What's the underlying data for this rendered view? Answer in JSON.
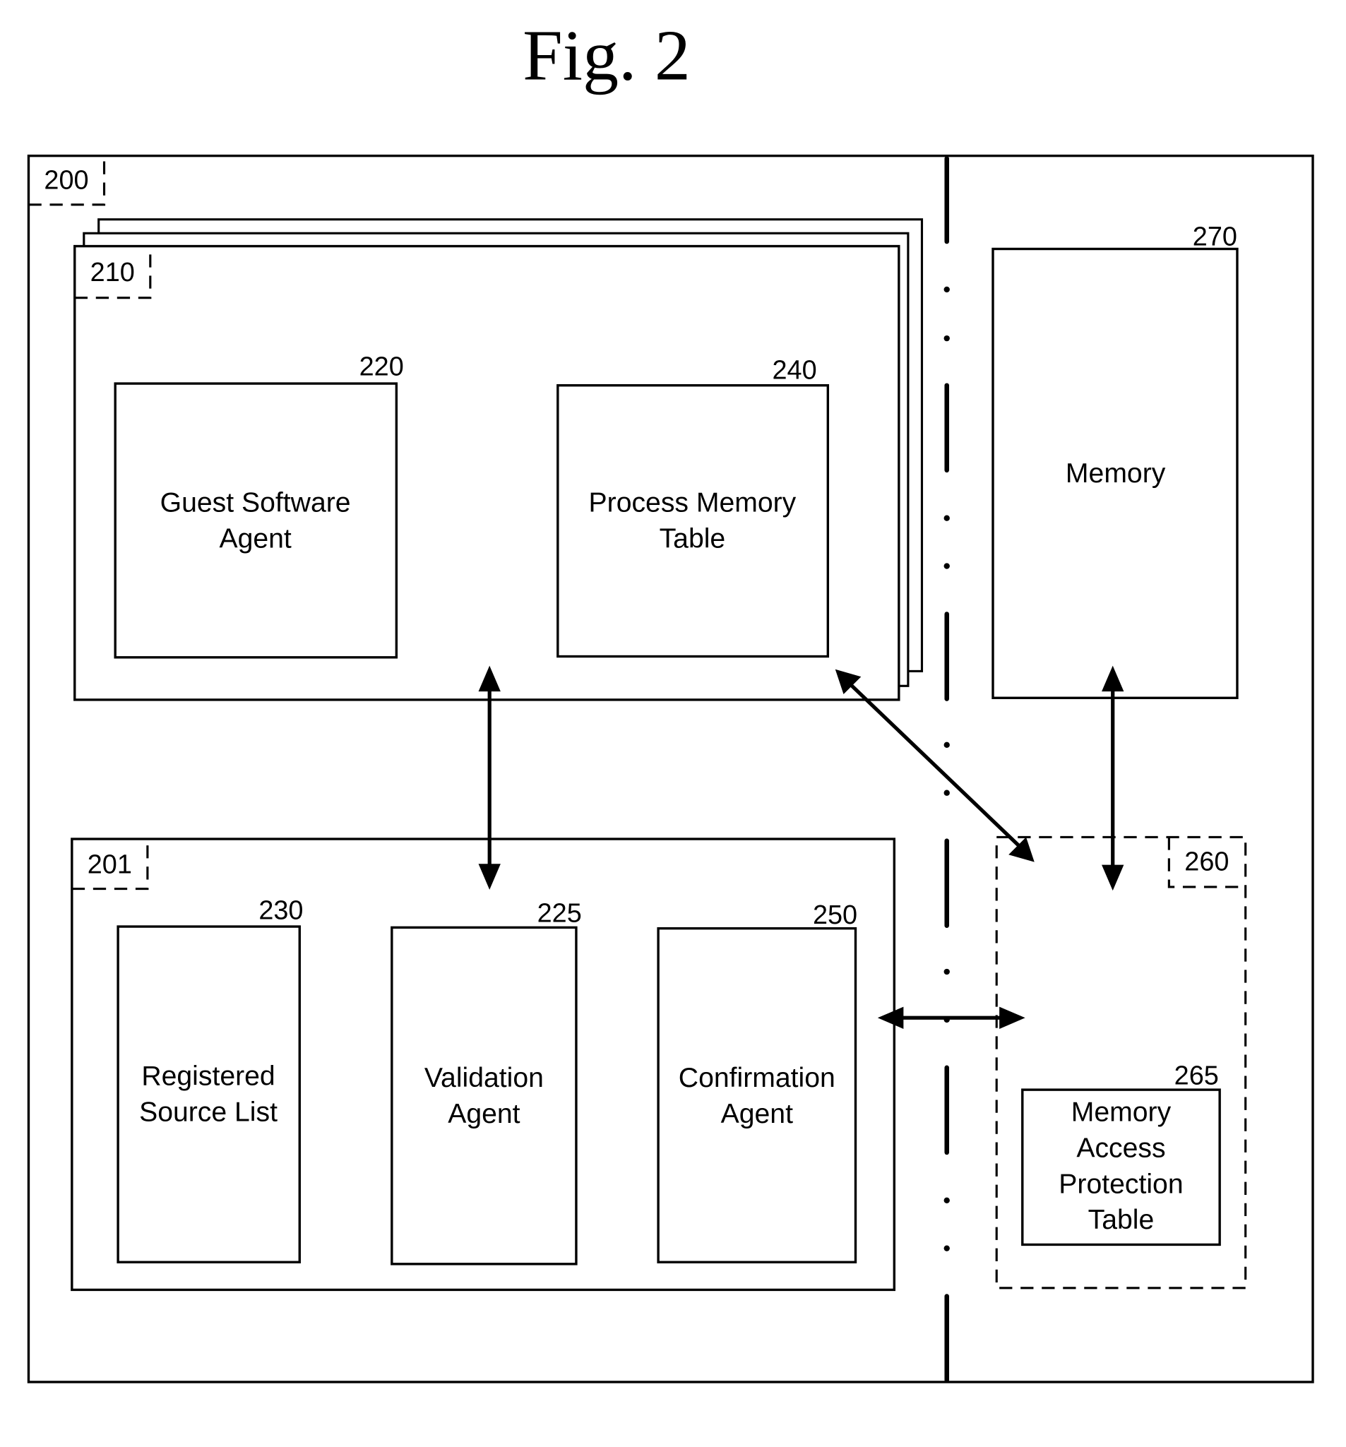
{
  "figure": {
    "title": "Fig. 2"
  },
  "components": {
    "system": {
      "ref": "200"
    },
    "guest_container": {
      "ref": "210"
    },
    "guest_software_agent": {
      "ref": "220",
      "label_lines": [
        "Guest Software",
        "Agent"
      ]
    },
    "process_memory_table": {
      "ref": "240",
      "label_lines": [
        "Process Memory",
        "Table"
      ]
    },
    "memory": {
      "ref": "270",
      "label_lines": [
        "Memory"
      ]
    },
    "validation_container": {
      "ref": "201"
    },
    "registered_source_list": {
      "ref": "230",
      "label_lines": [
        "Registered",
        "Source List"
      ]
    },
    "validation_agent": {
      "ref": "225",
      "label_lines": [
        "Validation",
        "Agent"
      ]
    },
    "confirmation_agent": {
      "ref": "250",
      "label_lines": [
        "Confirmation",
        "Agent"
      ]
    },
    "memory_controller": {
      "ref": "260"
    },
    "memory_access_protection_table": {
      "ref": "265",
      "label_lines": [
        "Memory",
        "Access",
        "Protection",
        "Table"
      ]
    }
  },
  "connections": [
    {
      "from": "guest_container",
      "to": "validation_agent",
      "type": "bidirectional"
    },
    {
      "from": "process_memory_table",
      "to": "memory_controller",
      "type": "bidirectional"
    },
    {
      "from": "memory",
      "to": "memory_controller",
      "type": "bidirectional"
    },
    {
      "from": "confirmation_agent",
      "to": "memory_controller",
      "type": "bidirectional"
    }
  ]
}
